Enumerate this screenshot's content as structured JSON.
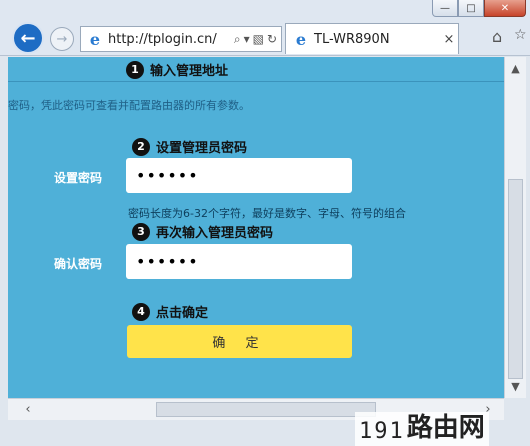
{
  "window": {
    "minimize_glyph": "—",
    "maximize_glyph": "□",
    "close_glyph": "✕"
  },
  "nav": {
    "back_glyph": "←",
    "forward_glyph": "→",
    "url": "http://tplogin.cn/",
    "search_glyph": "⌕",
    "dropdown_glyph": "▾",
    "compat_glyph": "▧",
    "refresh_glyph": "↻",
    "home_glyph": "⌂",
    "favorites_glyph": "☆"
  },
  "tab": {
    "title": "TL-WR890N",
    "close_glyph": "×",
    "icon": "ie-icon"
  },
  "content": {
    "step1": {
      "num": "1",
      "text": "输入管理地址"
    },
    "hint_top": "密码，凭此密码可查看并配置路由器的所有参数。",
    "step2": {
      "num": "2",
      "text": "设置管理员密码"
    },
    "password_label": "设置密码",
    "password_value": "••••••",
    "hint_length": "密码长度为6-32个字符，最好是数字、字母、符号的组合",
    "step3": {
      "num": "3",
      "text": "再次输入管理员密码"
    },
    "confirm_label": "确认密码",
    "confirm_value": "••••••",
    "step4": {
      "num": "4",
      "text": "点击确定"
    },
    "submit_label": "确 定"
  },
  "scrollbars": {
    "up_glyph": "▲",
    "down_glyph": "▼",
    "left_glyph": "‹",
    "right_glyph": "›"
  },
  "watermark": {
    "digits": "191",
    "brand": "路由网"
  },
  "colors": {
    "content_bg": "#4fb0d8",
    "button_bg": "#ffe34a",
    "back_button": "#1e6cc4"
  }
}
